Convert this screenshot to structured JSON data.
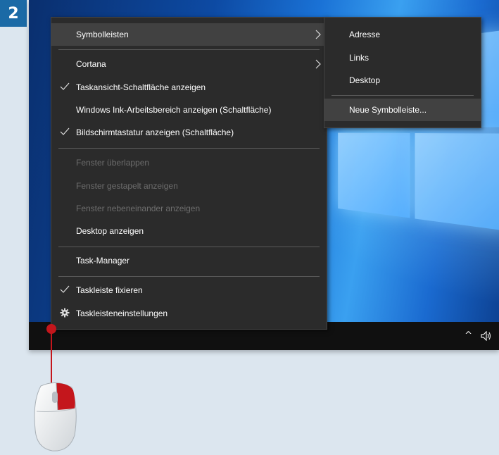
{
  "step": {
    "number": "2"
  },
  "context_menu": {
    "items": [
      {
        "label": "Symbolleisten",
        "checked": false,
        "disabled": false,
        "submenu": true
      },
      {
        "label": "Cortana",
        "checked": false,
        "disabled": false,
        "submenu": true
      },
      {
        "label": "Taskansicht-Schaltfläche anzeigen",
        "checked": true,
        "disabled": false
      },
      {
        "label": "Windows Ink-Arbeitsbereich anzeigen (Schaltfläche)",
        "checked": false,
        "disabled": false
      },
      {
        "label": "Bildschirmtastatur anzeigen (Schaltfläche)",
        "checked": true,
        "disabled": false
      },
      {
        "label": "Fenster überlappen",
        "checked": false,
        "disabled": true
      },
      {
        "label": "Fenster gestapelt anzeigen",
        "checked": false,
        "disabled": true
      },
      {
        "label": "Fenster nebeneinander anzeigen",
        "checked": false,
        "disabled": true
      },
      {
        "label": "Desktop anzeigen",
        "checked": false,
        "disabled": false
      },
      {
        "label": "Task-Manager",
        "checked": false,
        "disabled": false
      },
      {
        "label": "Taskleiste fixieren",
        "checked": true,
        "disabled": false
      },
      {
        "label": "Taskleisteneinstellungen",
        "icon": "gear-icon",
        "disabled": false
      }
    ]
  },
  "submenu": {
    "items": [
      {
        "label": "Adresse"
      },
      {
        "label": "Links"
      },
      {
        "label": "Desktop"
      },
      {
        "label": "Neue Symbolleiste..."
      }
    ]
  },
  "tray": {
    "chevron": "^",
    "volume_icon": "volume-icon"
  },
  "colors": {
    "accent_badge": "#1b6aa6",
    "menu_bg": "#2b2b2b",
    "pointer_red": "#c4161c"
  }
}
